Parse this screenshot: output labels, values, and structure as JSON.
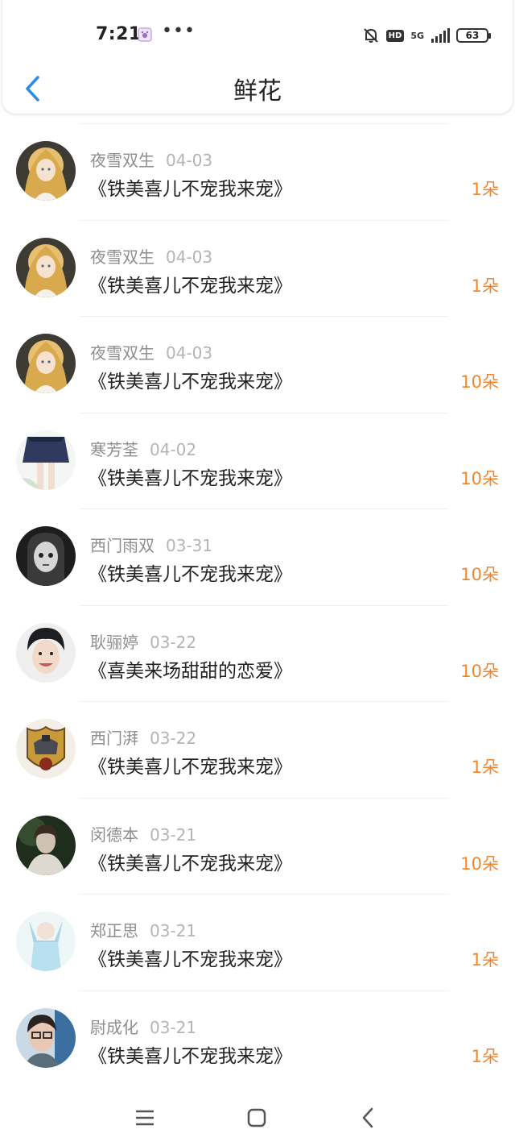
{
  "status_bar": {
    "time": "7:21",
    "more": "•••",
    "network": "5G",
    "hd": "HD",
    "battery": "63"
  },
  "nav": {
    "title": "鲜花"
  },
  "colors": {
    "accent_blue": "#2a8de6",
    "flower_orange": "#f0862d"
  },
  "items": [
    {
      "name": "夜雪双生",
      "date": "04-03",
      "book": "《铁美喜儿不宠我来宠》",
      "count": "1朵",
      "avatar": "anime-girl-avatar"
    },
    {
      "name": "夜雪双生",
      "date": "04-03",
      "book": "《铁美喜儿不宠我来宠》",
      "count": "1朵",
      "avatar": "anime-girl-avatar"
    },
    {
      "name": "夜雪双生",
      "date": "04-03",
      "book": "《铁美喜儿不宠我来宠》",
      "count": "10朵",
      "avatar": "anime-girl-avatar"
    },
    {
      "name": "寒芳荃",
      "date": "04-02",
      "book": "《铁美喜儿不宠我来宠》",
      "count": "10朵",
      "avatar": "skirt-avatar"
    },
    {
      "name": "西门雨双",
      "date": "03-31",
      "book": "《铁美喜儿不宠我来宠》",
      "count": "10朵",
      "avatar": "doll-face-avatar"
    },
    {
      "name": "耿骊婷",
      "date": "03-22",
      "book": "《喜美来场甜甜的恋爱》",
      "count": "10朵",
      "avatar": "young-man-avatar"
    },
    {
      "name": "西门湃",
      "date": "03-22",
      "book": "《铁美喜儿不宠我来宠》",
      "count": "1朵",
      "avatar": "emblem-avatar"
    },
    {
      "name": "闵德本",
      "date": "03-21",
      "book": "《铁美喜儿不宠我来宠》",
      "count": "10朵",
      "avatar": "dark-portrait-avatar"
    },
    {
      "name": "郑正思",
      "date": "03-21",
      "book": "《铁美喜儿不宠我来宠》",
      "count": "1朵",
      "avatar": "light-blue-avatar"
    },
    {
      "name": "尉成化",
      "date": "03-21",
      "book": "《铁美喜儿不宠我来宠》",
      "count": "1朵",
      "avatar": "glasses-avatar"
    }
  ]
}
